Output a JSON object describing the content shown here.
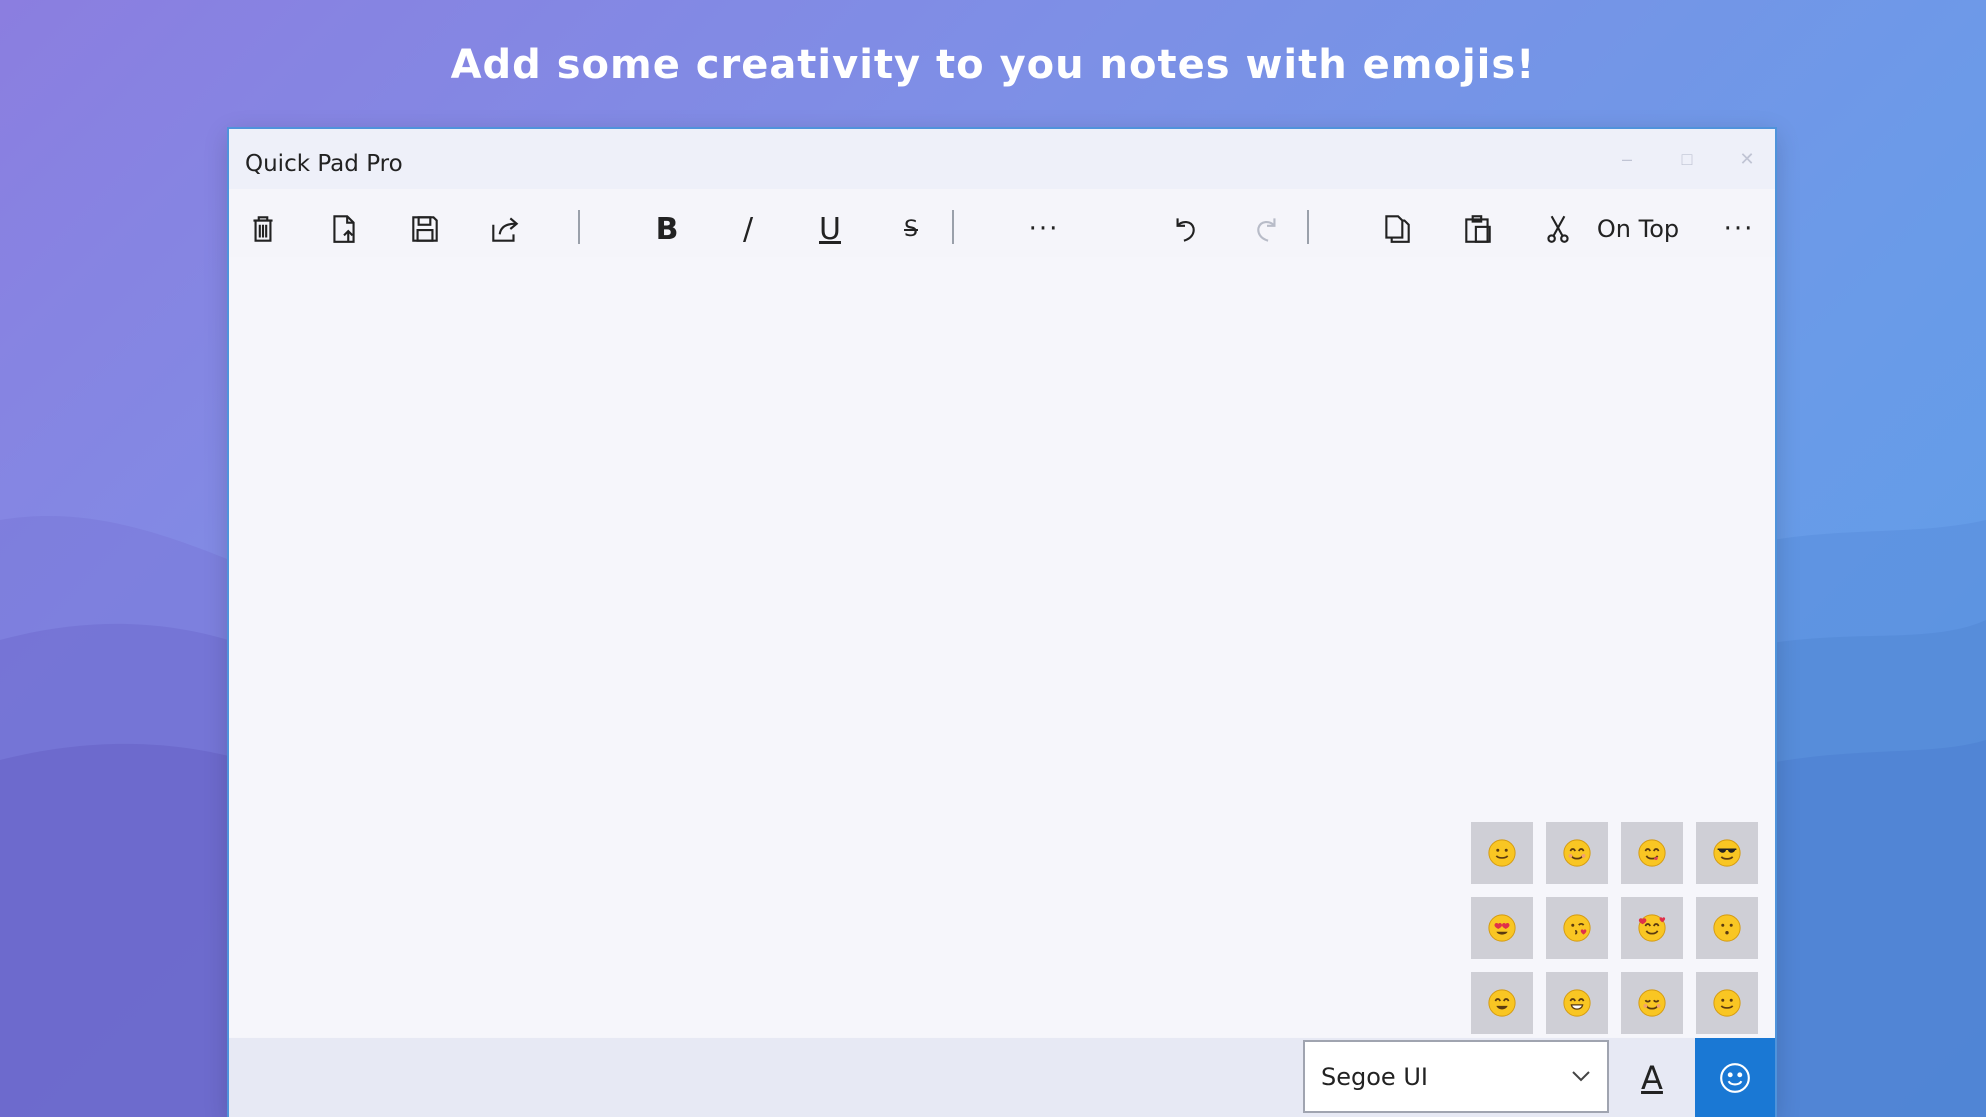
{
  "headline": "Add some creativity to you notes with emojis!",
  "window": {
    "title": "Quick Pad Pro",
    "controls": {
      "minimize": "–",
      "maximize": "□",
      "close": "✕"
    }
  },
  "toolbar": {
    "icons": [
      "delete-icon",
      "new-document-icon",
      "save-icon",
      "share-icon",
      "bold-icon",
      "italic-icon",
      "underline-icon",
      "strikethrough-icon",
      "more-formatting-icon",
      "undo-icon",
      "redo-icon",
      "copy-icon",
      "paste-icon",
      "cut-icon",
      "more-options-icon"
    ],
    "bold_label": "B",
    "italic_label": "/",
    "underline_label": "U",
    "strike_label": "S",
    "more_format_label": "···",
    "on_top_label": "On Top",
    "more_label": "···"
  },
  "emoji_panel": {
    "items": [
      "slightly-smiling-face",
      "smiling-face-with-smiling-eyes",
      "face-savoring-food",
      "smiling-face-with-sunglasses",
      "smiling-face-with-heart-eyes",
      "face-blowing-a-kiss",
      "smiling-face-with-hearts",
      "hushed-face",
      "grinning-squinting-face",
      "beaming-face",
      "relieved-smiling-face",
      "slightly-smiling-face"
    ]
  },
  "statusbar": {
    "font_name": "Segoe UI",
    "font_color_label": "A"
  },
  "colors": {
    "accent": "#1a78d4",
    "emoji_yellow": "#f9c623",
    "emoji_cell_bg": "#cfcfd6",
    "window_border": "#4f93db"
  }
}
